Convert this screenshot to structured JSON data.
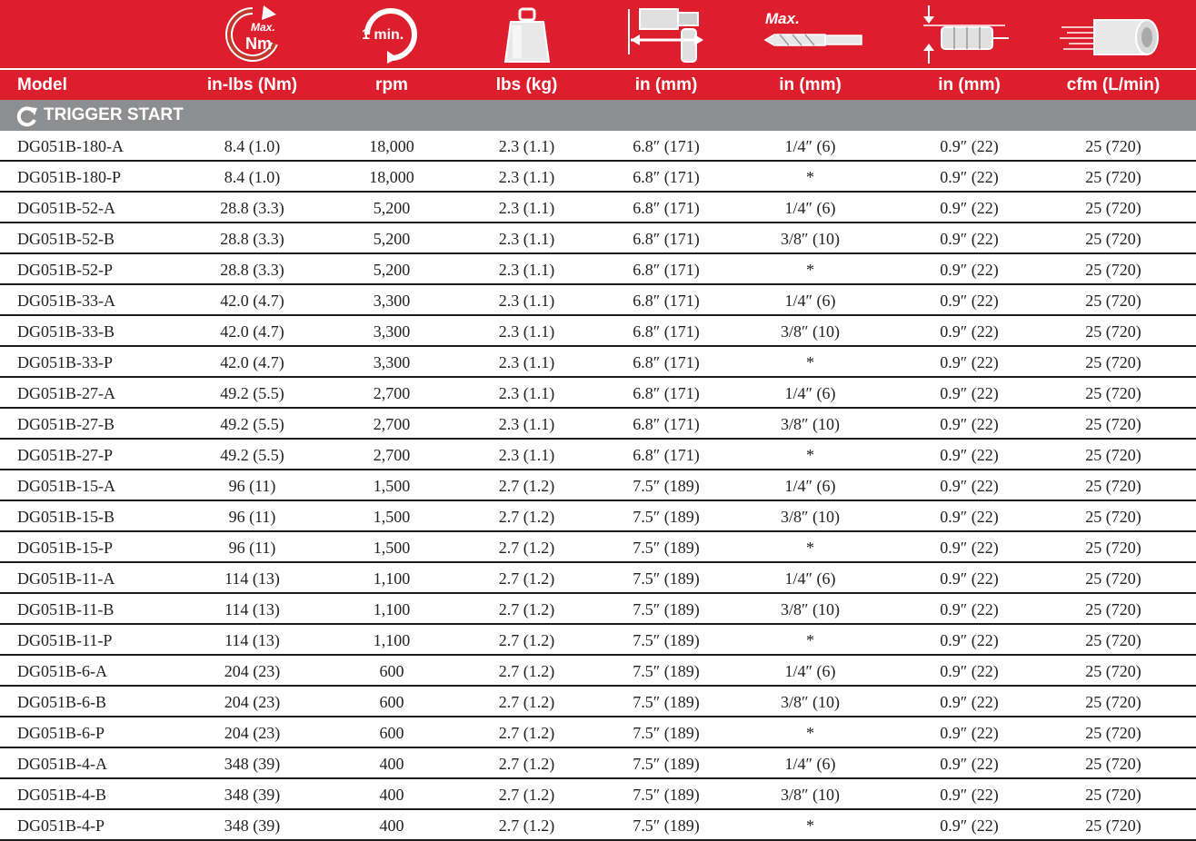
{
  "header": {
    "icons": [
      {
        "name": "torque-icon",
        "text_top": "Max.",
        "text_bottom": "Nm"
      },
      {
        "name": "speed-icon",
        "text": "1 min."
      },
      {
        "name": "weight-icon"
      },
      {
        "name": "length-icon"
      },
      {
        "name": "drill-bit-icon",
        "text": "Max."
      },
      {
        "name": "offset-icon"
      },
      {
        "name": "air-flow-icon"
      }
    ],
    "columns": [
      "Model",
      "in-lbs (Nm)",
      "rpm",
      "lbs (kg)",
      "in (mm)",
      "in (mm)",
      "in (mm)",
      "cfm (L/min)"
    ]
  },
  "section": {
    "icon": "refresh-icon",
    "label": "TRIGGER START"
  },
  "rows": [
    [
      "DG051B-180-A",
      "8.4 (1.0)",
      "18,000",
      "2.3 (1.1)",
      "6.8″ (171)",
      "1/4″ (6)",
      "0.9″ (22)",
      "25 (720)"
    ],
    [
      "DG051B-180-P",
      "8.4 (1.0)",
      "18,000",
      "2.3 (1.1)",
      "6.8″ (171)",
      "*",
      "0.9″ (22)",
      "25 (720)"
    ],
    [
      "DG051B-52-A",
      "28.8 (3.3)",
      "5,200",
      "2.3 (1.1)",
      "6.8″ (171)",
      "1/4″ (6)",
      "0.9″ (22)",
      "25 (720)"
    ],
    [
      "DG051B-52-B",
      "28.8 (3.3)",
      "5,200",
      "2.3 (1.1)",
      "6.8″ (171)",
      "3/8″ (10)",
      "0.9″ (22)",
      "25 (720)"
    ],
    [
      "DG051B-52-P",
      "28.8 (3.3)",
      "5,200",
      "2.3 (1.1)",
      "6.8″ (171)",
      "*",
      "0.9″ (22)",
      "25 (720)"
    ],
    [
      "DG051B-33-A",
      "42.0 (4.7)",
      "3,300",
      "2.3 (1.1)",
      "6.8″ (171)",
      "1/4″ (6)",
      "0.9″ (22)",
      "25 (720)"
    ],
    [
      "DG051B-33-B",
      "42.0 (4.7)",
      "3,300",
      "2.3 (1.1)",
      "6.8″ (171)",
      "3/8″ (10)",
      "0.9″ (22)",
      "25 (720)"
    ],
    [
      "DG051B-33-P",
      "42.0 (4.7)",
      "3,300",
      "2.3 (1.1)",
      "6.8″ (171)",
      "*",
      "0.9″ (22)",
      "25 (720)"
    ],
    [
      "DG051B-27-A",
      "49.2 (5.5)",
      "2,700",
      "2.3 (1.1)",
      "6.8″ (171)",
      "1/4″ (6)",
      "0.9″ (22)",
      "25 (720)"
    ],
    [
      "DG051B-27-B",
      "49.2 (5.5)",
      "2,700",
      "2.3 (1.1)",
      "6.8″ (171)",
      "3/8″ (10)",
      "0.9″ (22)",
      "25 (720)"
    ],
    [
      "DG051B-27-P",
      "49.2 (5.5)",
      "2,700",
      "2.3 (1.1)",
      "6.8″ (171)",
      "*",
      "0.9″ (22)",
      "25 (720)"
    ],
    [
      "DG051B-15-A",
      "96 (11)",
      "1,500",
      "2.7 (1.2)",
      "7.5″ (189)",
      "1/4″ (6)",
      "0.9″ (22)",
      "25 (720)"
    ],
    [
      "DG051B-15-B",
      "96 (11)",
      "1,500",
      "2.7 (1.2)",
      "7.5″ (189)",
      "3/8″ (10)",
      "0.9″ (22)",
      "25 (720)"
    ],
    [
      "DG051B-15-P",
      "96 (11)",
      "1,500",
      "2.7 (1.2)",
      "7.5″ (189)",
      "*",
      "0.9″ (22)",
      "25 (720)"
    ],
    [
      "DG051B-11-A",
      "114 (13)",
      "1,100",
      "2.7 (1.2)",
      "7.5″ (189)",
      "1/4″ (6)",
      "0.9″ (22)",
      "25 (720)"
    ],
    [
      "DG051B-11-B",
      "114 (13)",
      "1,100",
      "2.7 (1.2)",
      "7.5″ (189)",
      "3/8″ (10)",
      "0.9″ (22)",
      "25 (720)"
    ],
    [
      "DG051B-11-P",
      "114 (13)",
      "1,100",
      "2.7 (1.2)",
      "7.5″ (189)",
      "*",
      "0.9″ (22)",
      "25 (720)"
    ],
    [
      "DG051B-6-A",
      "204 (23)",
      "600",
      "2.7 (1.2)",
      "7.5″ (189)",
      "1/4″ (6)",
      "0.9″ (22)",
      "25 (720)"
    ],
    [
      "DG051B-6-B",
      "204  (23)",
      "600",
      "2.7 (1.2)",
      "7.5″ (189)",
      "3/8″ (10)",
      "0.9″ (22)",
      "25 (720)"
    ],
    [
      "DG051B-6-P",
      "204 (23)",
      "600",
      "2.7 (1.2)",
      "7.5″ (189)",
      "*",
      "0.9″ (22)",
      "25 (720)"
    ],
    [
      "DG051B-4-A",
      "348 (39)",
      "400",
      "2.7 (1.2)",
      "7.5″ (189)",
      "1/4″ (6)",
      "0.9″ (22)",
      "25 (720)"
    ],
    [
      "DG051B-4-B",
      "348 (39)",
      "400",
      "2.7 (1.2)",
      "7.5″ (189)",
      "3/8″ (10)",
      "0.9″ (22)",
      "25 (720)"
    ],
    [
      "DG051B-4-P",
      "348 (39)",
      "400",
      "2.7 (1.2)",
      "7.5″ (189)",
      "*",
      "0.9″ (22)",
      "25 (720)"
    ]
  ]
}
